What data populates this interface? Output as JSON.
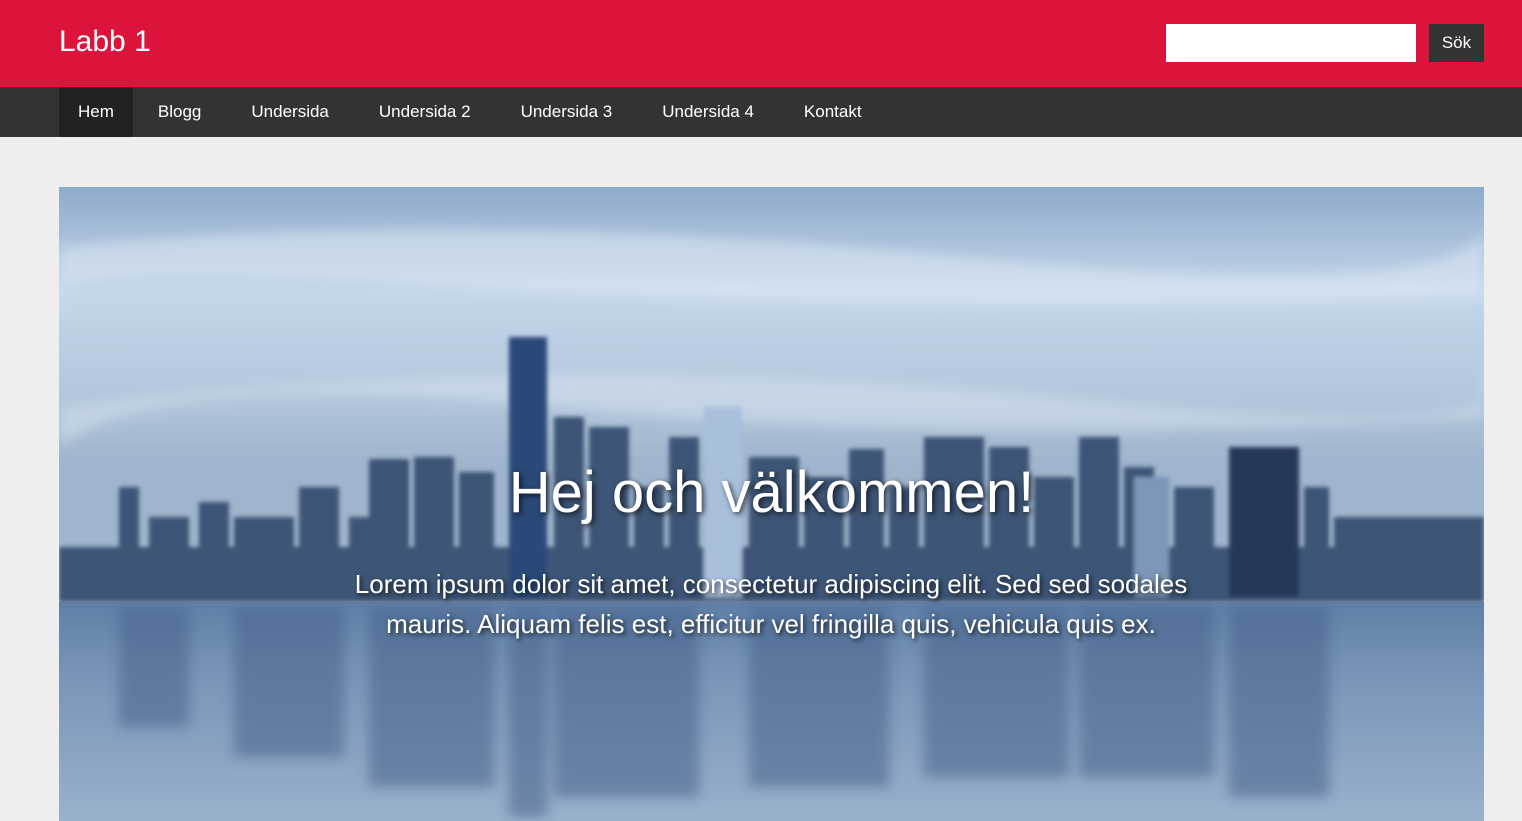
{
  "header": {
    "site_title": "Labb 1",
    "search": {
      "value": "",
      "placeholder": ""
    },
    "search_button_label": "Sök",
    "background_color": "#dc143c"
  },
  "nav": {
    "items": [
      {
        "label": "Hem",
        "active": true
      },
      {
        "label": "Blogg",
        "active": false
      },
      {
        "label": "Undersida",
        "active": false
      },
      {
        "label": "Undersida 2",
        "active": false
      },
      {
        "label": "Undersida 3",
        "active": false
      },
      {
        "label": "Undersida 4",
        "active": false
      },
      {
        "label": "Kontakt",
        "active": false
      }
    ],
    "background_color": "#333333"
  },
  "hero": {
    "title": "Hej och välkommen!",
    "text": "Lorem ipsum dolor sit amet, consectetur adipiscing elit. Sed sed sodales mauris. Aliquam felis est, efficitur vel fringilla quis, vehicula quis ex."
  }
}
